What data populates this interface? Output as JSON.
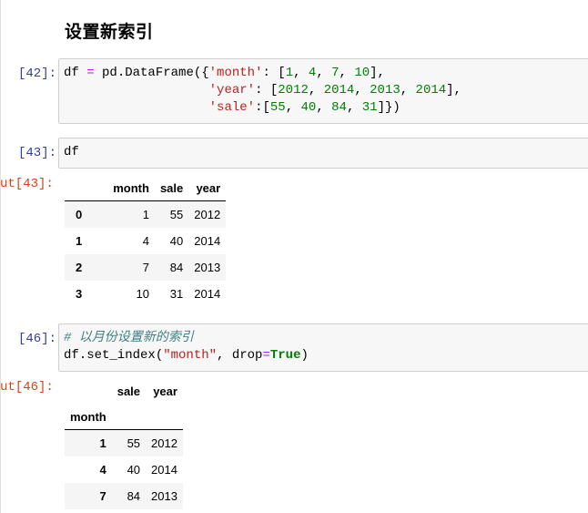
{
  "heading": "设置新索引",
  "cells": {
    "c42": {
      "prompt": "[42]:",
      "lines": [
        [
          [
            "t",
            "df "
          ],
          [
            "o",
            "="
          ],
          [
            "t",
            " pd.DataFrame({"
          ],
          [
            "s",
            "'month'"
          ],
          [
            "t",
            ": ["
          ],
          [
            "n",
            "1"
          ],
          [
            "t",
            ", "
          ],
          [
            "n",
            "4"
          ],
          [
            "t",
            ", "
          ],
          [
            "n",
            "7"
          ],
          [
            "t",
            ", "
          ],
          [
            "n",
            "10"
          ],
          [
            "t",
            "],"
          ]
        ],
        [
          [
            "t",
            "                   "
          ],
          [
            "s",
            "'year'"
          ],
          [
            "t",
            ": ["
          ],
          [
            "n",
            "2012"
          ],
          [
            "t",
            ", "
          ],
          [
            "n",
            "2014"
          ],
          [
            "t",
            ", "
          ],
          [
            "n",
            "2013"
          ],
          [
            "t",
            ", "
          ],
          [
            "n",
            "2014"
          ],
          [
            "t",
            "],"
          ]
        ],
        [
          [
            "t",
            "                   "
          ],
          [
            "s",
            "'sale'"
          ],
          [
            "t",
            ":["
          ],
          [
            "n",
            "55"
          ],
          [
            "t",
            ", "
          ],
          [
            "n",
            "40"
          ],
          [
            "t",
            ", "
          ],
          [
            "n",
            "84"
          ],
          [
            "t",
            ", "
          ],
          [
            "n",
            "31"
          ],
          [
            "t",
            "]})"
          ]
        ]
      ]
    },
    "c43": {
      "prompt": "[43]:",
      "out_prompt": "ut[43]:",
      "lines": [
        [
          [
            "t",
            "df"
          ]
        ]
      ],
      "table": {
        "columns": [
          "month",
          "sale",
          "year"
        ],
        "rows": [
          [
            "0",
            "1",
            "55",
            "2012"
          ],
          [
            "1",
            "4",
            "40",
            "2014"
          ],
          [
            "2",
            "7",
            "84",
            "2013"
          ],
          [
            "3",
            "10",
            "31",
            "2014"
          ]
        ]
      }
    },
    "c46": {
      "prompt": "[46]:",
      "out_prompt": "ut[46]:",
      "lines": [
        [
          [
            "c",
            "# 以月份设置新的索引"
          ]
        ],
        [
          [
            "t",
            "df.set_index("
          ],
          [
            "s",
            "\"month\""
          ],
          [
            "t",
            ", drop"
          ],
          [
            "o",
            "="
          ],
          [
            "b",
            "True"
          ],
          [
            "t",
            ")"
          ]
        ]
      ],
      "table": {
        "columns": [
          "sale",
          "year"
        ],
        "index_name": "month",
        "rows": [
          [
            "1",
            "55",
            "2012"
          ],
          [
            "4",
            "40",
            "2014"
          ],
          [
            "7",
            "84",
            "2013"
          ]
        ]
      }
    }
  }
}
